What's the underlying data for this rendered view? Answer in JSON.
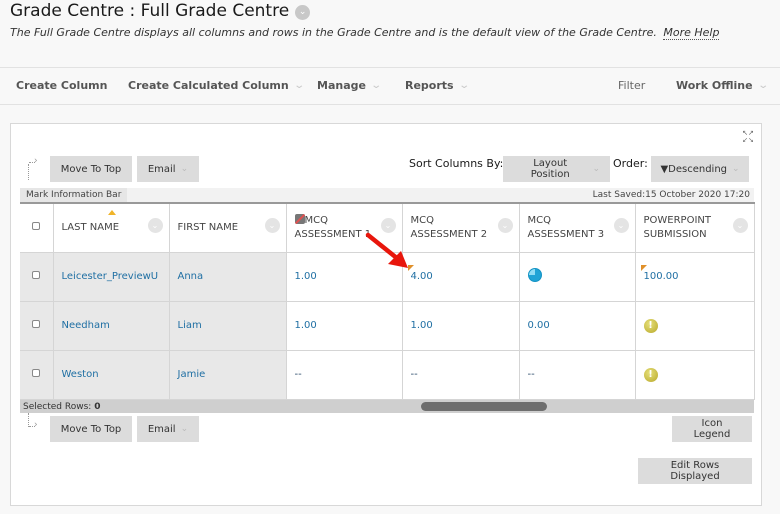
{
  "header": {
    "title": "Grade Centre : Full Grade Centre",
    "description": "The Full Grade Centre displays all columns and rows in the Grade Centre and is the default view of the Grade Centre.",
    "more_help": "More Help"
  },
  "action_bar": {
    "create_column": "Create Column",
    "create_calculated_column": "Create Calculated Column",
    "manage": "Manage",
    "reports": "Reports",
    "filter": "Filter",
    "work_offline": "Work Offline"
  },
  "toolbar": {
    "move_to_top": "Move To Top",
    "email": "Email",
    "sort_columns_by_label": "Sort Columns By:",
    "sort_columns_by_value": "Layout Position",
    "order_label": "Order:",
    "order_value": "▼Descending"
  },
  "info_bar": {
    "mark_information_bar": "Mark Information Bar",
    "last_saved": "Last Saved:15 October 2020 17:20"
  },
  "grid": {
    "columns": [
      {
        "line1": "LAST NAME",
        "line2": ""
      },
      {
        "line1": "FIRST NAME",
        "line2": ""
      },
      {
        "line1": "MCQ",
        "line2": "ASSESSMENT 1"
      },
      {
        "line1": "MCQ",
        "line2": "ASSESSMENT 2"
      },
      {
        "line1": "MCQ",
        "line2": "ASSESSMENT 3"
      },
      {
        "line1": "POWERPOINT",
        "line2": "SUBMISSION"
      }
    ],
    "rows": [
      {
        "last_name": "Leicester_PreviewU",
        "first_name": "Anna",
        "mcq1": "1.00",
        "mcq2": "4.00",
        "mcq3": "in-progress-icon",
        "ppt": "100.00"
      },
      {
        "last_name": "Needham",
        "first_name": "Liam",
        "mcq1": "1.00",
        "mcq2": "1.00",
        "mcq3": "0.00",
        "ppt": "needs-grading-icon"
      },
      {
        "last_name": "Weston",
        "first_name": "Jamie",
        "mcq1": "--",
        "mcq2": "--",
        "mcq3": "--",
        "ppt": "needs-grading-icon"
      }
    ]
  },
  "footer": {
    "selected_rows_label": "Selected Rows:",
    "selected_rows_count": "0",
    "move_to_top": "Move To Top",
    "email": "Email",
    "icon_legend": "Icon Legend",
    "edit_rows_displayed": "Edit Rows Displayed"
  },
  "colors": {
    "link": "#1f6fa3",
    "annotation_arrow": "#e8160c",
    "flag": "#e0902a",
    "sort_caret": "#f0b429"
  }
}
